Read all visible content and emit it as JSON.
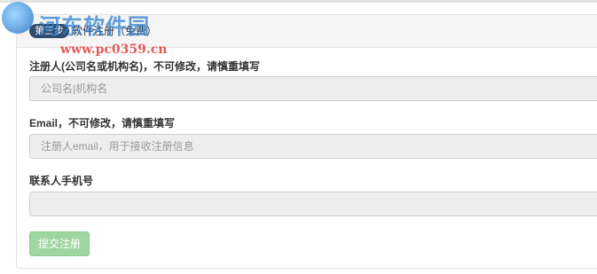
{
  "panel": {
    "step_badge": "第三步",
    "title": "软件注册（免费）"
  },
  "form": {
    "company_label": "注册人(公司名或机构名)，不可修改，请慎重填写",
    "company_placeholder": "公司名|机构名",
    "email_label": "Email，不可修改，请慎重填写",
    "email_placeholder": "注册人email，用于接收注册信息",
    "phone_label": "联系人手机号",
    "phone_placeholder": "",
    "submit_label": "提交注册"
  },
  "watermark": {
    "title": "河东软件园",
    "url": "www.pc0359.cn"
  }
}
